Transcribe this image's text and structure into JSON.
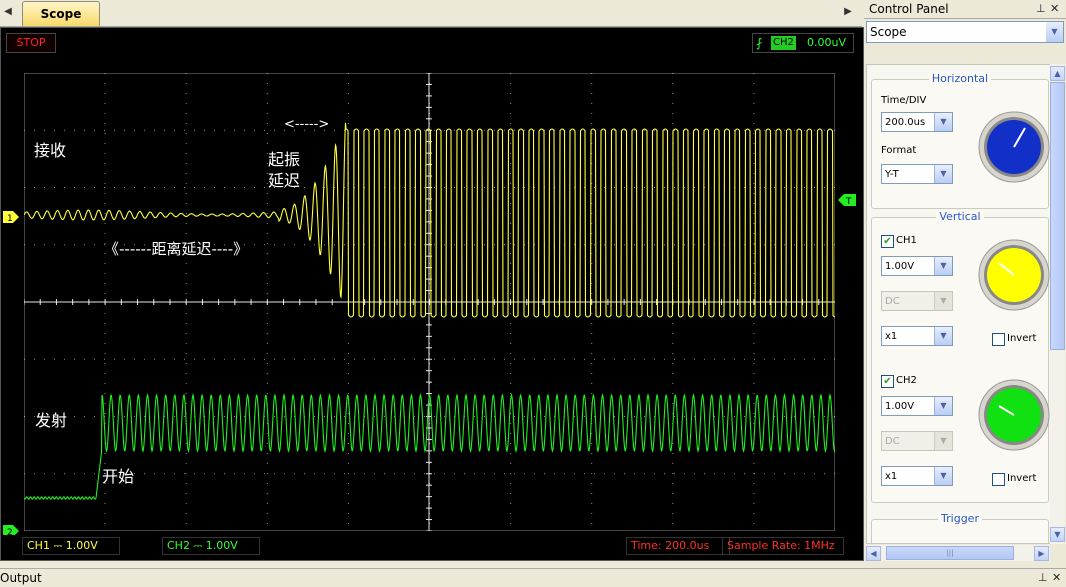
{
  "tabs": [
    {
      "label": "Scope",
      "active": true
    }
  ],
  "scope": {
    "run_state": "STOP",
    "trigger_channel": "CH2",
    "trigger_level": "0.00uV",
    "channel_markers": [
      "1",
      "2"
    ],
    "trigger_marker": "T",
    "annotations": {
      "receive": "接收",
      "osc_delay_line1": "起振",
      "osc_delay_line2": "延迟",
      "osc_delay_arrow": "<----->",
      "distance_delay": "《------距离延迟----》",
      "transmit": "发射",
      "start": "开始"
    },
    "status": {
      "ch1": "CH1 ⎓  1.00V",
      "ch2": "CH2 ⎓  1.00V",
      "time": "Time: 200.0us",
      "sample_rate": "Sample Rate: 1MHz"
    },
    "colors": {
      "ch1": "#ffff3a",
      "ch2": "#22ee22",
      "grid": "#ffffff",
      "background": "#000000"
    }
  },
  "control_panel": {
    "title": "Control Panel",
    "view_select": "Scope",
    "horizontal": {
      "label": "Horizontal",
      "time_div_label": "Time/DIV",
      "time_div_value": "200.0us",
      "format_label": "Format",
      "format_value": "Y-T",
      "knob_color": "#1230c8"
    },
    "vertical": {
      "label": "Vertical",
      "ch1": {
        "label": "CH1",
        "checked": true,
        "volts": "1.00V",
        "coupling": "DC",
        "probe": "x1",
        "invert_label": "Invert",
        "knob_color": "#ffff00"
      },
      "ch2": {
        "label": "CH2",
        "checked": true,
        "volts": "1.00V",
        "coupling": "DC",
        "probe": "x1",
        "invert_label": "Invert",
        "knob_color": "#11e011"
      }
    },
    "trigger": {
      "label": "Trigger"
    }
  },
  "output": {
    "label": "Output"
  }
}
